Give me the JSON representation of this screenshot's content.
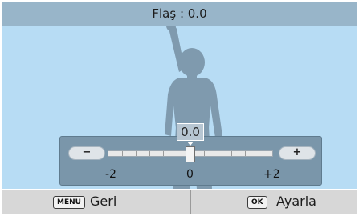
{
  "header": {
    "title": "Flaş : 0.0"
  },
  "flash_slider": {
    "current_value": "0.0",
    "value": 0.0,
    "min": -2,
    "max": 2,
    "min_label": "-2",
    "center_label": "0",
    "max_label": "+2",
    "decrease_label": "−",
    "increase_label": "+"
  },
  "footer": {
    "back_key": "MENU",
    "back_label": "Geri",
    "ok_key": "OK",
    "ok_label": "Ayarla"
  }
}
